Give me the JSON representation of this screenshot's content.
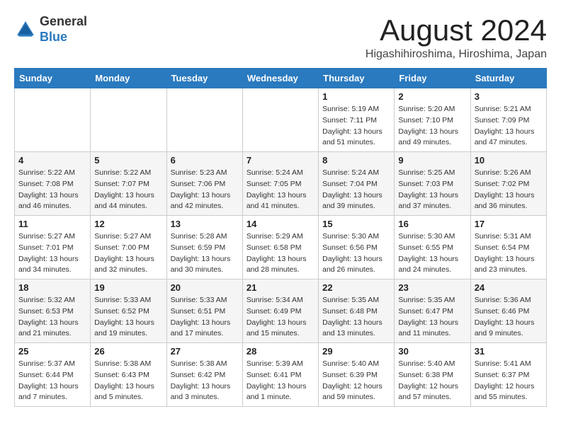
{
  "header": {
    "logo_general": "General",
    "logo_blue": "Blue",
    "month_year": "August 2024",
    "location": "Higashihiroshima, Hiroshima, Japan"
  },
  "weekdays": [
    "Sunday",
    "Monday",
    "Tuesday",
    "Wednesday",
    "Thursday",
    "Friday",
    "Saturday"
  ],
  "weeks": [
    [
      {
        "day": "",
        "info": ""
      },
      {
        "day": "",
        "info": ""
      },
      {
        "day": "",
        "info": ""
      },
      {
        "day": "",
        "info": ""
      },
      {
        "day": "1",
        "info": "Sunrise: 5:19 AM\nSunset: 7:11 PM\nDaylight: 13 hours\nand 51 minutes."
      },
      {
        "day": "2",
        "info": "Sunrise: 5:20 AM\nSunset: 7:10 PM\nDaylight: 13 hours\nand 49 minutes."
      },
      {
        "day": "3",
        "info": "Sunrise: 5:21 AM\nSunset: 7:09 PM\nDaylight: 13 hours\nand 47 minutes."
      }
    ],
    [
      {
        "day": "4",
        "info": "Sunrise: 5:22 AM\nSunset: 7:08 PM\nDaylight: 13 hours\nand 46 minutes."
      },
      {
        "day": "5",
        "info": "Sunrise: 5:22 AM\nSunset: 7:07 PM\nDaylight: 13 hours\nand 44 minutes."
      },
      {
        "day": "6",
        "info": "Sunrise: 5:23 AM\nSunset: 7:06 PM\nDaylight: 13 hours\nand 42 minutes."
      },
      {
        "day": "7",
        "info": "Sunrise: 5:24 AM\nSunset: 7:05 PM\nDaylight: 13 hours\nand 41 minutes."
      },
      {
        "day": "8",
        "info": "Sunrise: 5:24 AM\nSunset: 7:04 PM\nDaylight: 13 hours\nand 39 minutes."
      },
      {
        "day": "9",
        "info": "Sunrise: 5:25 AM\nSunset: 7:03 PM\nDaylight: 13 hours\nand 37 minutes."
      },
      {
        "day": "10",
        "info": "Sunrise: 5:26 AM\nSunset: 7:02 PM\nDaylight: 13 hours\nand 36 minutes."
      }
    ],
    [
      {
        "day": "11",
        "info": "Sunrise: 5:27 AM\nSunset: 7:01 PM\nDaylight: 13 hours\nand 34 minutes."
      },
      {
        "day": "12",
        "info": "Sunrise: 5:27 AM\nSunset: 7:00 PM\nDaylight: 13 hours\nand 32 minutes."
      },
      {
        "day": "13",
        "info": "Sunrise: 5:28 AM\nSunset: 6:59 PM\nDaylight: 13 hours\nand 30 minutes."
      },
      {
        "day": "14",
        "info": "Sunrise: 5:29 AM\nSunset: 6:58 PM\nDaylight: 13 hours\nand 28 minutes."
      },
      {
        "day": "15",
        "info": "Sunrise: 5:30 AM\nSunset: 6:56 PM\nDaylight: 13 hours\nand 26 minutes."
      },
      {
        "day": "16",
        "info": "Sunrise: 5:30 AM\nSunset: 6:55 PM\nDaylight: 13 hours\nand 24 minutes."
      },
      {
        "day": "17",
        "info": "Sunrise: 5:31 AM\nSunset: 6:54 PM\nDaylight: 13 hours\nand 23 minutes."
      }
    ],
    [
      {
        "day": "18",
        "info": "Sunrise: 5:32 AM\nSunset: 6:53 PM\nDaylight: 13 hours\nand 21 minutes."
      },
      {
        "day": "19",
        "info": "Sunrise: 5:33 AM\nSunset: 6:52 PM\nDaylight: 13 hours\nand 19 minutes."
      },
      {
        "day": "20",
        "info": "Sunrise: 5:33 AM\nSunset: 6:51 PM\nDaylight: 13 hours\nand 17 minutes."
      },
      {
        "day": "21",
        "info": "Sunrise: 5:34 AM\nSunset: 6:49 PM\nDaylight: 13 hours\nand 15 minutes."
      },
      {
        "day": "22",
        "info": "Sunrise: 5:35 AM\nSunset: 6:48 PM\nDaylight: 13 hours\nand 13 minutes."
      },
      {
        "day": "23",
        "info": "Sunrise: 5:35 AM\nSunset: 6:47 PM\nDaylight: 13 hours\nand 11 minutes."
      },
      {
        "day": "24",
        "info": "Sunrise: 5:36 AM\nSunset: 6:46 PM\nDaylight: 13 hours\nand 9 minutes."
      }
    ],
    [
      {
        "day": "25",
        "info": "Sunrise: 5:37 AM\nSunset: 6:44 PM\nDaylight: 13 hours\nand 7 minutes."
      },
      {
        "day": "26",
        "info": "Sunrise: 5:38 AM\nSunset: 6:43 PM\nDaylight: 13 hours\nand 5 minutes."
      },
      {
        "day": "27",
        "info": "Sunrise: 5:38 AM\nSunset: 6:42 PM\nDaylight: 13 hours\nand 3 minutes."
      },
      {
        "day": "28",
        "info": "Sunrise: 5:39 AM\nSunset: 6:41 PM\nDaylight: 13 hours\nand 1 minute."
      },
      {
        "day": "29",
        "info": "Sunrise: 5:40 AM\nSunset: 6:39 PM\nDaylight: 12 hours\nand 59 minutes."
      },
      {
        "day": "30",
        "info": "Sunrise: 5:40 AM\nSunset: 6:38 PM\nDaylight: 12 hours\nand 57 minutes."
      },
      {
        "day": "31",
        "info": "Sunrise: 5:41 AM\nSunset: 6:37 PM\nDaylight: 12 hours\nand 55 minutes."
      }
    ]
  ]
}
